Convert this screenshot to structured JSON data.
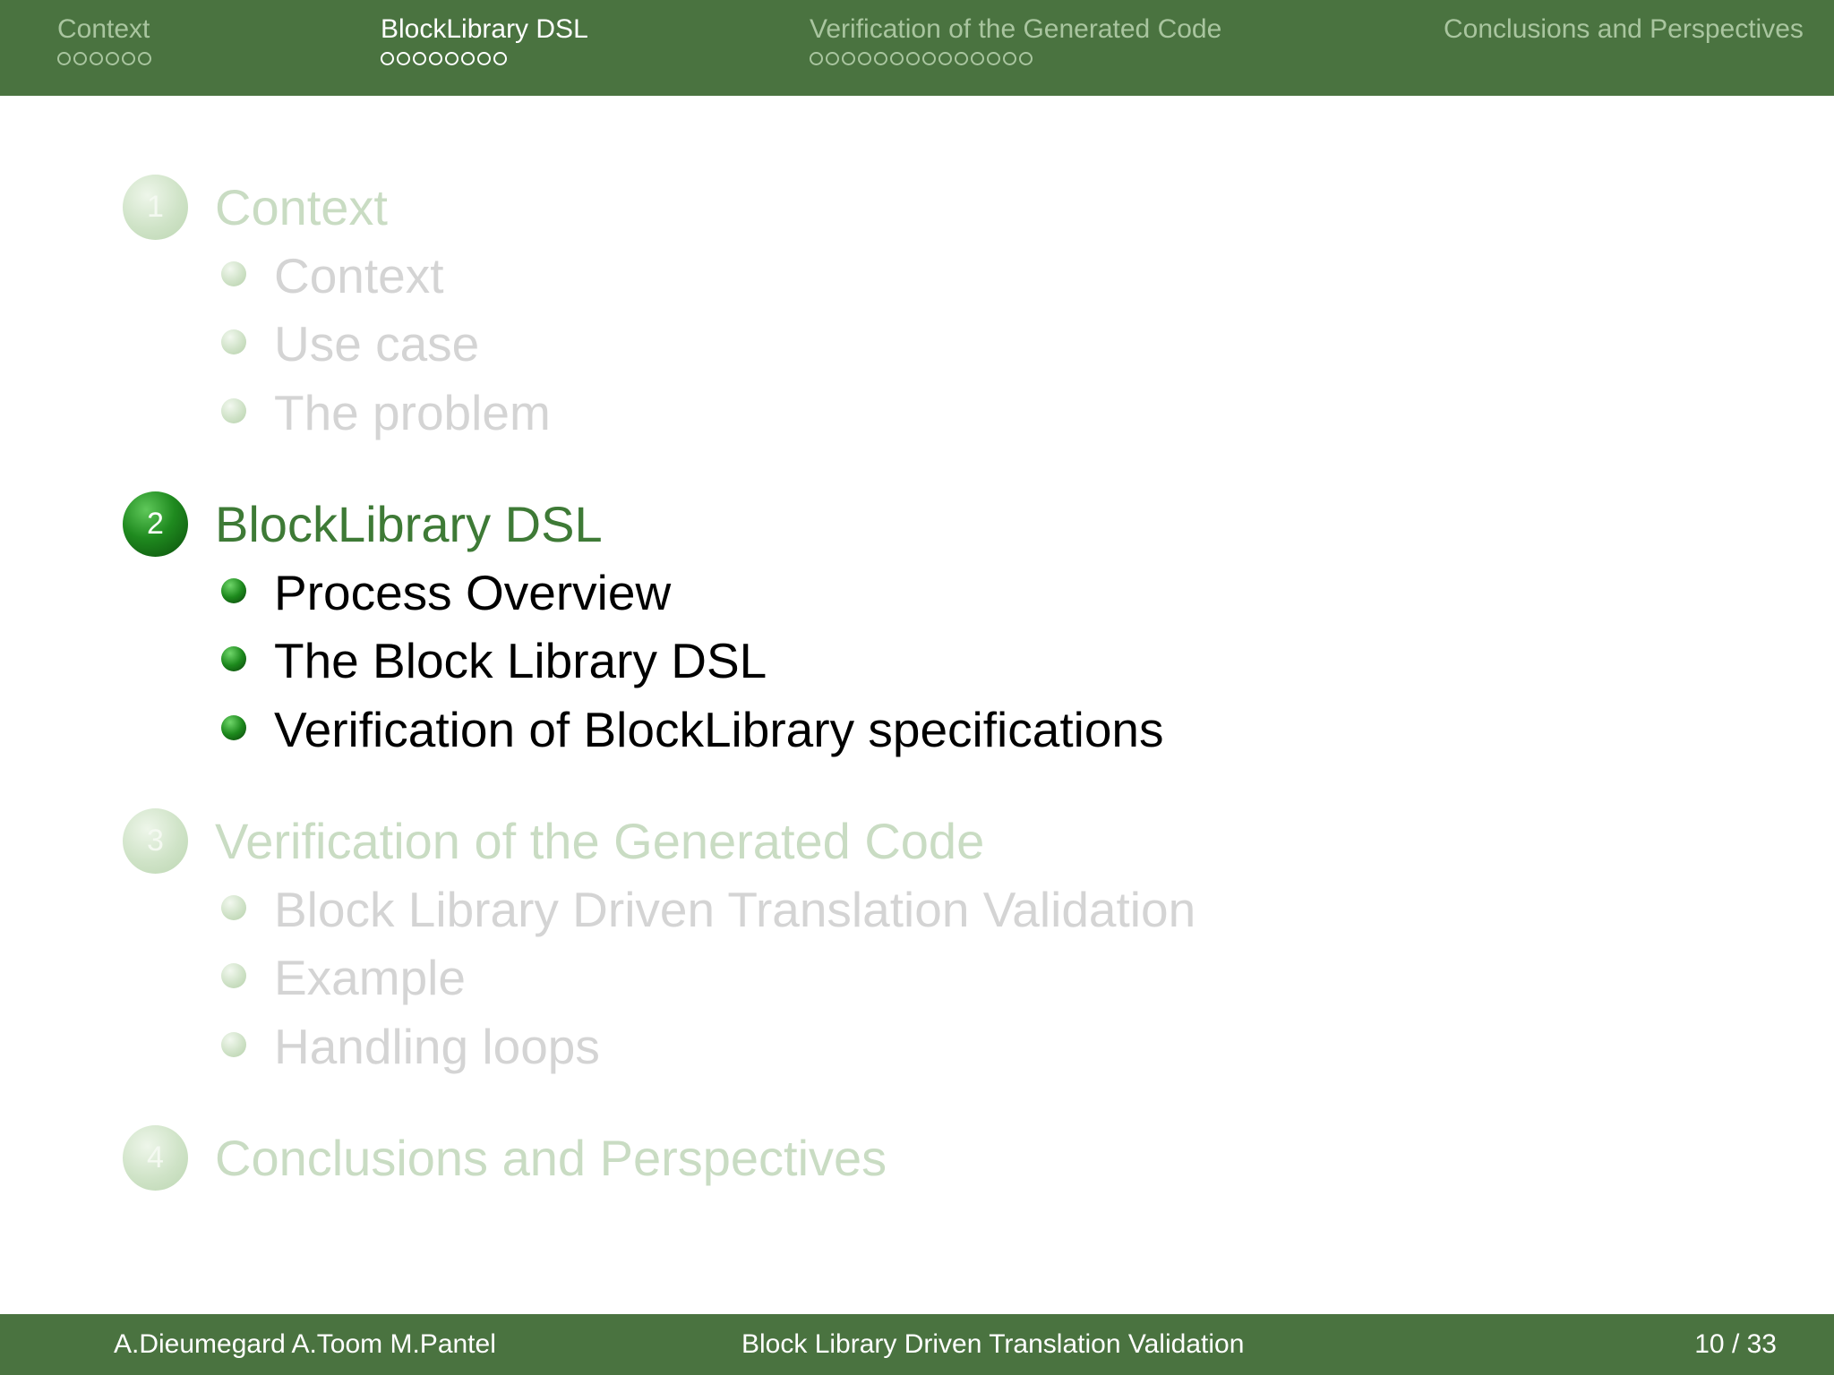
{
  "header": {
    "sections": [
      {
        "label": "Context",
        "dots": 6,
        "active": false
      },
      {
        "label": "BlockLibrary DSL",
        "dots": 8,
        "active": true
      },
      {
        "label": "Verification of the Generated Code",
        "dots": 14,
        "active": false
      },
      {
        "label": "Conclusions and Perspectives",
        "dots": 0,
        "active": false
      }
    ]
  },
  "outline": [
    {
      "number": "1",
      "title": "Context",
      "state": "faded",
      "items": [
        "Context",
        "Use case",
        "The problem"
      ]
    },
    {
      "number": "2",
      "title": "BlockLibrary DSL",
      "state": "current",
      "items": [
        "Process Overview",
        "The Block Library DSL",
        "Verification of BlockLibrary specifications"
      ]
    },
    {
      "number": "3",
      "title": "Verification of the Generated Code",
      "state": "faded",
      "items": [
        "Block Library Driven Translation Validation",
        "Example",
        "Handling loops"
      ]
    },
    {
      "number": "4",
      "title": "Conclusions and Perspectives",
      "state": "faded",
      "items": []
    }
  ],
  "footer": {
    "authors": "A.Dieumegard A.Toom M.Pantel",
    "title": "Block Library Driven Translation Validation",
    "page": "10 / 33"
  },
  "colors": {
    "bar": "#4a7340",
    "current_title": "#3e7a36",
    "faded_text": "#d4d4d4",
    "faded_title": "#c9dcc3"
  }
}
